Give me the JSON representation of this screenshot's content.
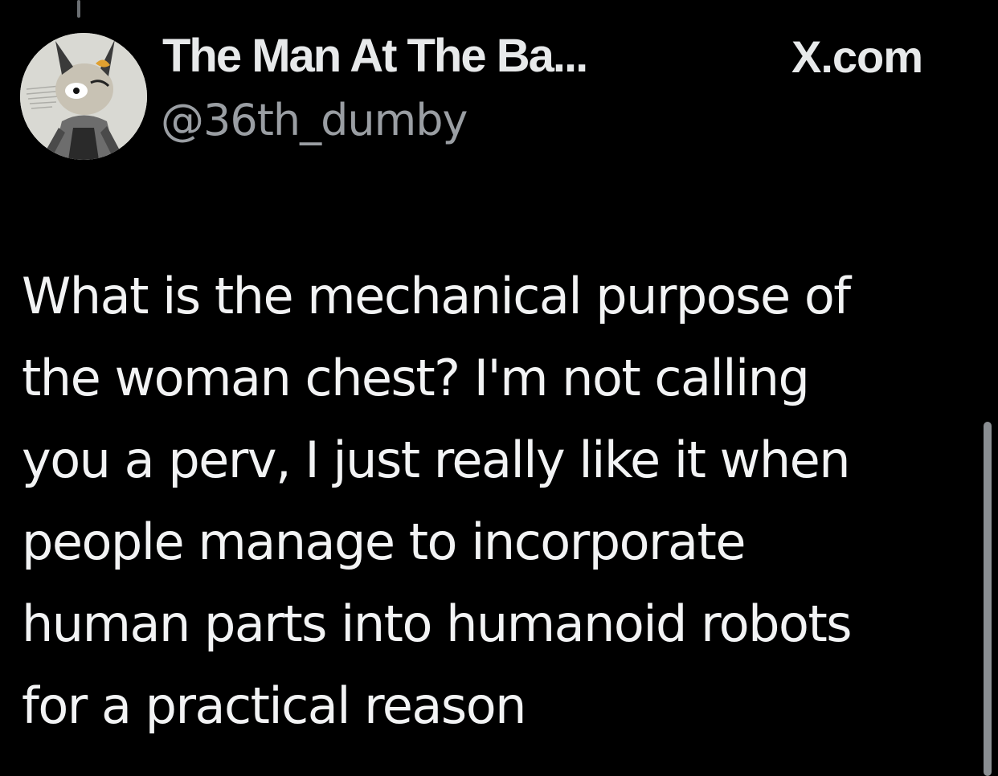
{
  "tweet": {
    "display_name": "The Man At The Ba...",
    "handle": "@36th_dumby",
    "source": "X.com",
    "lines": [
      "What is the mechanical purpose of",
      "the woman chest? I'm not calling",
      "you a perv, I just really like it when",
      "people manage to incorporate",
      "human parts into humanoid robots",
      "for a practical reason"
    ]
  },
  "avatar": {
    "icon": "drawn-character-avatar"
  },
  "colors": {
    "background": "#000000",
    "primary_text": "#e7e9ea",
    "secondary_text": "#9a9ea3"
  }
}
